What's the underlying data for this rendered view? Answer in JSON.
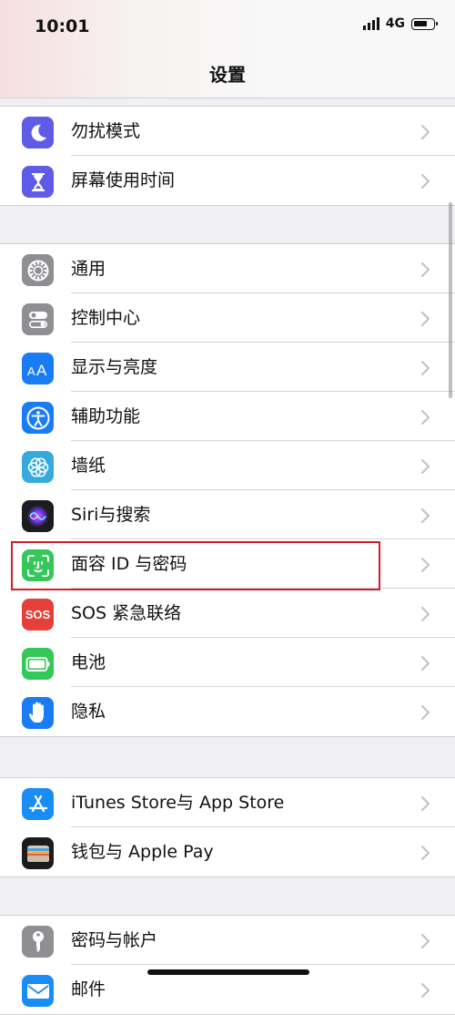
{
  "status_bar": {
    "time": "10:01",
    "network": "4G"
  },
  "nav": {
    "title": "设置"
  },
  "groups": [
    {
      "items": [
        {
          "label": "勿扰模式",
          "icon": "moon-icon",
          "color": "#5e5ce6"
        },
        {
          "label": "屏幕使用时间",
          "icon": "hourglass-icon",
          "color": "#5e5ce6"
        }
      ]
    },
    {
      "items": [
        {
          "label": "通用",
          "icon": "gear-icon",
          "color": "#8e8e93"
        },
        {
          "label": "控制中心",
          "icon": "toggles-icon",
          "color": "#8e8e93"
        },
        {
          "label": "显示与亮度",
          "icon": "text-size-icon",
          "color": "#1a7cf5"
        },
        {
          "label": "辅助功能",
          "icon": "accessibility-icon",
          "color": "#1a7cf5"
        },
        {
          "label": "墙纸",
          "icon": "flower-icon",
          "color": "#36aadc"
        },
        {
          "label": "Siri与搜索",
          "icon": "siri-icon",
          "color": "#1c1c1e"
        },
        {
          "label": "面容 ID 与密码",
          "icon": "face-id-icon",
          "color": "#34c759"
        },
        {
          "label": "SOS 紧急联络",
          "icon": "sos-icon",
          "color": "#e5413a",
          "icon_text": "SOS"
        },
        {
          "label": "电池",
          "icon": "battery-icon",
          "color": "#34c759"
        },
        {
          "label": "隐私",
          "icon": "hand-icon",
          "color": "#1a7cf5"
        }
      ]
    },
    {
      "items": [
        {
          "label": "iTunes Store与 App Store",
          "icon": "app-store-icon",
          "color": "#1a8cf5"
        },
        {
          "label": "钱包与 Apple Pay",
          "icon": "wallet-icon",
          "color": "#1c1c1e"
        }
      ]
    },
    {
      "items": [
        {
          "label": "密码与帐户",
          "icon": "key-icon",
          "color": "#8e8e93"
        },
        {
          "label": "邮件",
          "icon": "mail-icon",
          "color": "#1a8cf5"
        }
      ]
    }
  ]
}
